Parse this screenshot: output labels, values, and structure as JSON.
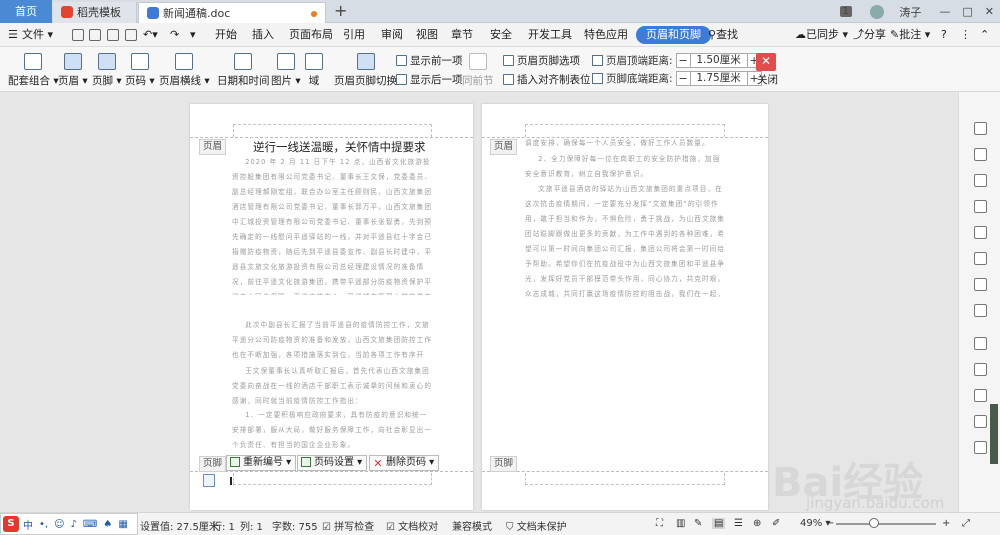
{
  "tabs": {
    "home": "首页",
    "templates": "稻壳模板",
    "document": "新闻通稿.doc"
  },
  "window": {
    "page_badge": "1",
    "user": "涛子"
  },
  "menubar": {
    "file": "文件",
    "items": [
      "开始",
      "插入",
      "页面布局",
      "引用",
      "审阅",
      "视图",
      "章节",
      "安全",
      "开发工具",
      "特色应用"
    ],
    "active": "页眉和页脚",
    "search": "查找",
    "sync": "已同步",
    "share": "分享",
    "comment": "批注"
  },
  "ribbon": {
    "combo": "配套组合",
    "header": "页眉",
    "footer": "页脚",
    "page_number": "页码",
    "header_line": "页眉横线",
    "datetime": "日期和时间",
    "picture": "图片",
    "field": "域",
    "switch": "页眉页脚切换",
    "show_prev": "显示前一项",
    "show_next": "显示后一项",
    "same_as_prev": "同前节",
    "options": "页眉页脚选项",
    "insert_tab": "插入对齐制表位",
    "header_top_label": "页眉顶端距离:",
    "header_top_value": "1.50厘米",
    "footer_bottom_label": "页脚底端距离:",
    "footer_bottom_value": "1.75厘米",
    "close": "关闭"
  },
  "page1": {
    "header_tag": "页眉",
    "footer_tag": "页脚",
    "title": "逆行一线送温暖，关怀情中提要求",
    "paragraphs": [
      "2020 年 2 月 11 日下午 12 点，山西省文化旅游投资控股集团有限公司党委书记、董事长王文保，党委委员、副总经理郝刚宏组，联合办公室主任顾则民，山西文旅集团酒店管理有限公司党委书记、董事长郭万平，山西文旅集团中汇城投资管理有限公司党委书记、董事长张智勇，先到预先确定的一线慰问平遥驿站的一线，并对平遥县红十字会已捐赠防疫物资，随后先到平遥县委宣传、副县长时建中，平遥县文旅文化旅游投资有限公司总经理建设情况的准备情况，前往平遥文化旅游集团，携带平遥部分防疫物资保护平遥中心同步保障，平遥文旅中心、平遥城市管理乡村旅游中心的防疫物资发放，以及平遥县政府相关部门提供的各项目支持。",
      "此次中副县长汇报了当前平遥县的疫情防控工作，文旅平遥分公司防疫物资的准备和发放，山西文旅集团防控工作也在不断加强，各项措施落实到位，当前各项工作有序开展。",
      "王文保董事长认真听取汇报后，首先代表山西文旅集团党委向奋战在一线的酒店干部职工表示诚挚的问候和衷心的感谢，同时就当前疫情防控工作指出：",
      "1、一定要积极响应政府要求，具有防疫的意识和统一安排部署，服从大局，做好服务保障工作，向社会彰显出一个负责任、有担当的国企企业形象。"
    ],
    "footer_buttons": {
      "renumber": "重新编号",
      "page_settings": "页码设置",
      "delete_page_number": "删除页码"
    }
  },
  "page2": {
    "header_tag": "页眉",
    "footer_tag": "页脚",
    "paragraphs": [
      "调度安排，确保每一个人员安全，做好工作人员数量。",
      "2、全力保障好每一位在岗职工的安全防护措施，加强安全意识教育，树立自我保护意识。",
      "文旅平遥县酒店的驿站为山西文旅集团的重点项目，在这次抗击疫情期间，一定要充分发挥“文旅集团”的引领作用，敢于担当和作为，不惧危险，勇于挑战，为山西文旅集团站稳脚跟做出更多的贡献，为工作中遇到的各种困难，希望可以第一时间向集团公司汇报，集团公司将会第一时间给予帮助。希望你们在抗疫战役中为山西文旅集团和平遥县争光，发挥好党员干部模范带头作用，同心协力，共克时艰，众志成城，共同打赢这场疫情防控的阻击战，我们在一起，必能取得抗击疫情斗争的全面胜利。"
    ]
  },
  "status": {
    "position": "设置值: 27.5厘米",
    "row": "行: 1",
    "col": "列: 1",
    "wordcount": "字数: 755",
    "spellcheck": "拼写检查",
    "proof": "文档校对",
    "compat": "兼容模式",
    "protect": "文档未保护",
    "zoom": "49%"
  },
  "ime": {
    "logo": "S",
    "mode": "中"
  },
  "watermark": {
    "brand": "Bai经验",
    "url": "jingyan.baidu.com"
  }
}
